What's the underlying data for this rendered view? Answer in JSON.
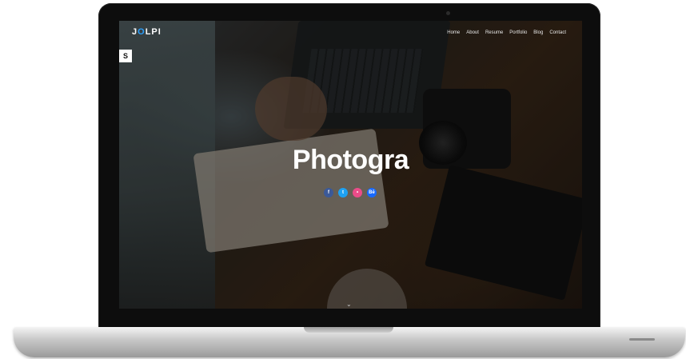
{
  "site": {
    "brand": "JOLPI",
    "nav": [
      "Home",
      "About",
      "Resume",
      "Portfolio",
      "Blog",
      "Contact"
    ],
    "side_icon": "S",
    "headline": "Photogra",
    "socials": [
      {
        "icon": "facebook-icon",
        "label": "f",
        "color": "#3b5998"
      },
      {
        "icon": "twitter-icon",
        "label": "t",
        "color": "#1da1f2"
      },
      {
        "icon": "dribbble-icon",
        "label": "•",
        "color": "#ea4c89"
      },
      {
        "icon": "behance-icon",
        "label": "Bē",
        "color": "#1769ff"
      }
    ],
    "scroll_glyph": "⌄"
  }
}
